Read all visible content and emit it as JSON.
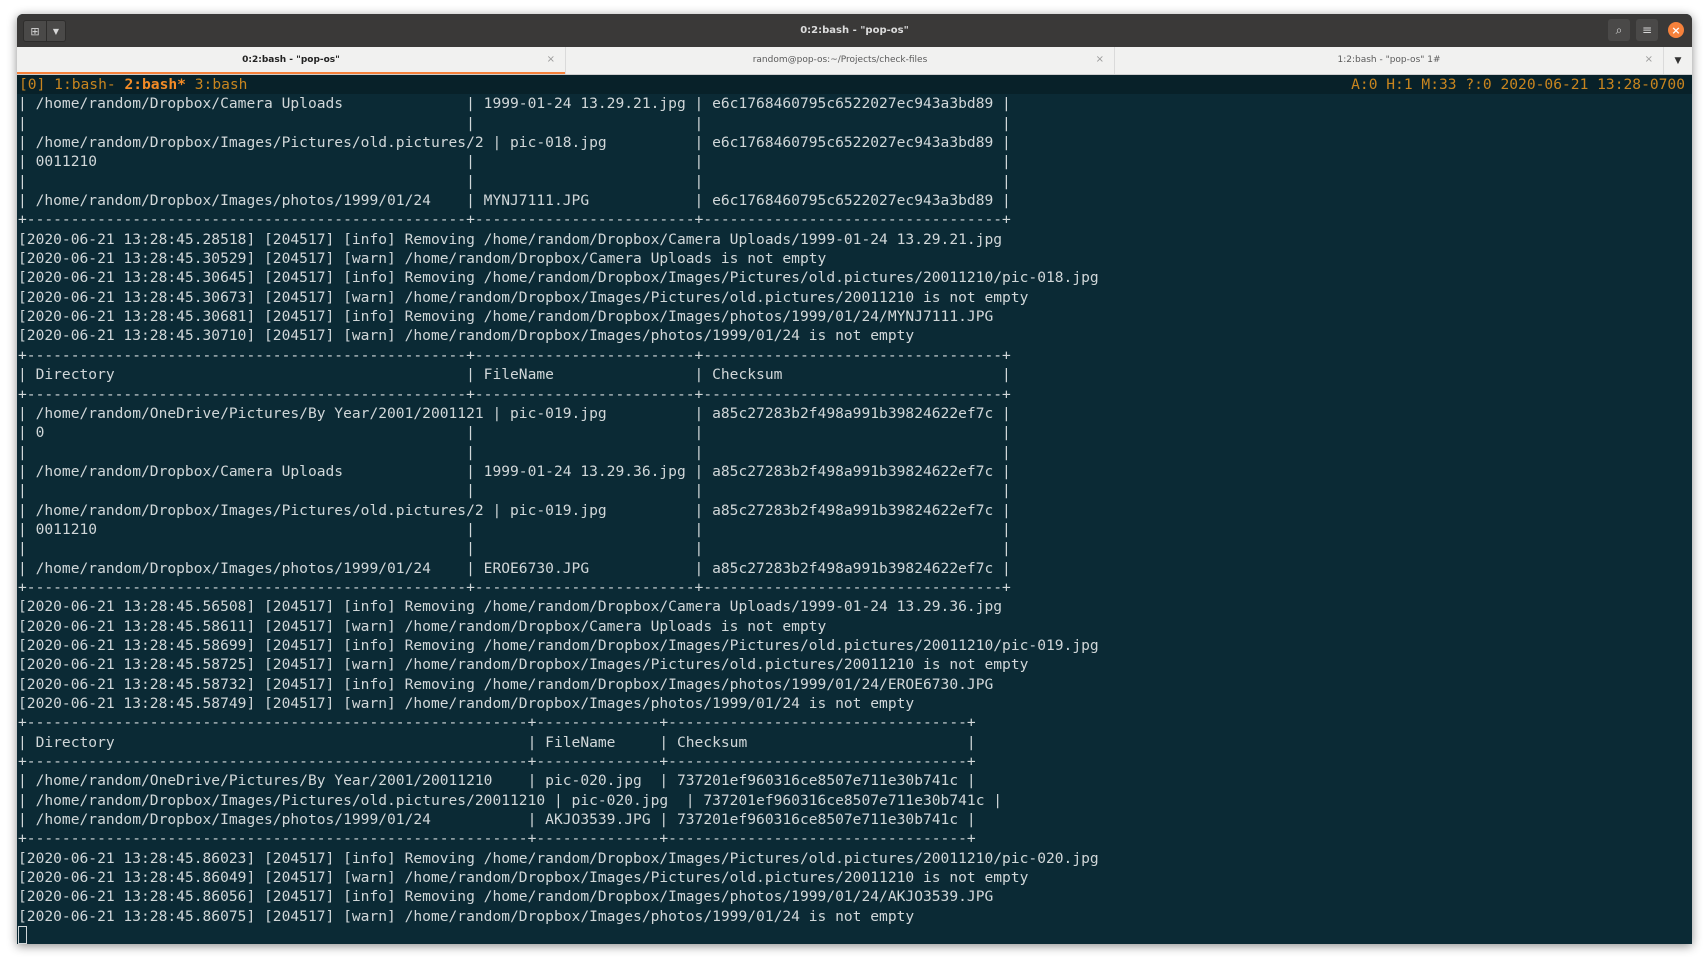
{
  "window": {
    "title": "0:2:bash - \"pop-os\""
  },
  "tabs": [
    {
      "label": "0:2:bash - \"pop-os\"",
      "active": true
    },
    {
      "label": "random@pop-os:~/Projects/check-files",
      "active": false
    },
    {
      "label": "1:2:bash - \"pop-os\" 1#",
      "active": false
    }
  ],
  "status": {
    "session": "[0] ",
    "win1": "1:bash- ",
    "win2": "2:bash*",
    "win3": " 3:bash",
    "right": "A:0 H:1 M:33 ?:0 2020-06-21 13:28-0700"
  },
  "lines": [
    "| /home/random/Dropbox/Camera Uploads              | 1999-01-24 13.29.21.jpg | e6c1768460795c6522027ec943a3bd89 |",
    "|                                                  |                         |                                  |",
    "| /home/random/Dropbox/Images/Pictures/old.pictures/2 | pic-018.jpg          | e6c1768460795c6522027ec943a3bd89 |",
    "| 0011210                                          |                         |                                  |",
    "|                                                  |                         |                                  |",
    "| /home/random/Dropbox/Images/photos/1999/01/24    | MYNJ7111.JPG            | e6c1768460795c6522027ec943a3bd89 |",
    "+--------------------------------------------------+-------------------------+----------------------------------+",
    "[2020-06-21 13:28:45.28518] [204517] [info] Removing /home/random/Dropbox/Camera Uploads/1999-01-24 13.29.21.jpg",
    "[2020-06-21 13:28:45.30529] [204517] [warn] /home/random/Dropbox/Camera Uploads is not empty",
    "[2020-06-21 13:28:45.30645] [204517] [info] Removing /home/random/Dropbox/Images/Pictures/old.pictures/20011210/pic-018.jpg",
    "[2020-06-21 13:28:45.30673] [204517] [warn] /home/random/Dropbox/Images/Pictures/old.pictures/20011210 is not empty",
    "[2020-06-21 13:28:45.30681] [204517] [info] Removing /home/random/Dropbox/Images/photos/1999/01/24/MYNJ7111.JPG",
    "[2020-06-21 13:28:45.30710] [204517] [warn] /home/random/Dropbox/Images/photos/1999/01/24 is not empty",
    "+--------------------------------------------------+-------------------------+----------------------------------+",
    "| Directory                                        | FileName                | Checksum                         |",
    "+--------------------------------------------------+-------------------------+----------------------------------+",
    "| /home/random/OneDrive/Pictures/By Year/2001/2001121 | pic-019.jpg          | a85c27283b2f498a991b39824622ef7c |",
    "| 0                                                |                         |                                  |",
    "|                                                  |                         |                                  |",
    "| /home/random/Dropbox/Camera Uploads              | 1999-01-24 13.29.36.jpg | a85c27283b2f498a991b39824622ef7c |",
    "|                                                  |                         |                                  |",
    "| /home/random/Dropbox/Images/Pictures/old.pictures/2 | pic-019.jpg          | a85c27283b2f498a991b39824622ef7c |",
    "| 0011210                                          |                         |                                  |",
    "|                                                  |                         |                                  |",
    "| /home/random/Dropbox/Images/photos/1999/01/24    | EROE6730.JPG            | a85c27283b2f498a991b39824622ef7c |",
    "+--------------------------------------------------+-------------------------+----------------------------------+",
    "[2020-06-21 13:28:45.56508] [204517] [info] Removing /home/random/Dropbox/Camera Uploads/1999-01-24 13.29.36.jpg",
    "[2020-06-21 13:28:45.58611] [204517] [warn] /home/random/Dropbox/Camera Uploads is not empty",
    "[2020-06-21 13:28:45.58699] [204517] [info] Removing /home/random/Dropbox/Images/Pictures/old.pictures/20011210/pic-019.jpg",
    "[2020-06-21 13:28:45.58725] [204517] [warn] /home/random/Dropbox/Images/Pictures/old.pictures/20011210 is not empty",
    "[2020-06-21 13:28:45.58732] [204517] [info] Removing /home/random/Dropbox/Images/photos/1999/01/24/EROE6730.JPG",
    "[2020-06-21 13:28:45.58749] [204517] [warn] /home/random/Dropbox/Images/photos/1999/01/24 is not empty",
    "+---------------------------------------------------------+--------------+----------------------------------+",
    "| Directory                                               | FileName     | Checksum                         |",
    "+---------------------------------------------------------+--------------+----------------------------------+",
    "| /home/random/OneDrive/Pictures/By Year/2001/20011210    | pic-020.jpg  | 737201ef960316ce8507e711e30b741c |",
    "| /home/random/Dropbox/Images/Pictures/old.pictures/20011210 | pic-020.jpg  | 737201ef960316ce8507e711e30b741c |",
    "| /home/random/Dropbox/Images/photos/1999/01/24           | AKJO3539.JPG | 737201ef960316ce8507e711e30b741c |",
    "+---------------------------------------------------------+--------------+----------------------------------+",
    "[2020-06-21 13:28:45.86023] [204517] [info] Removing /home/random/Dropbox/Images/Pictures/old.pictures/20011210/pic-020.jpg",
    "[2020-06-21 13:28:45.86049] [204517] [warn] /home/random/Dropbox/Images/Pictures/old.pictures/20011210 is not empty",
    "[2020-06-21 13:28:45.86056] [204517] [info] Removing /home/random/Dropbox/Images/photos/1999/01/24/AKJO3539.JPG",
    "[2020-06-21 13:28:45.86075] [204517] [warn] /home/random/Dropbox/Images/photos/1999/01/24 is not empty"
  ]
}
